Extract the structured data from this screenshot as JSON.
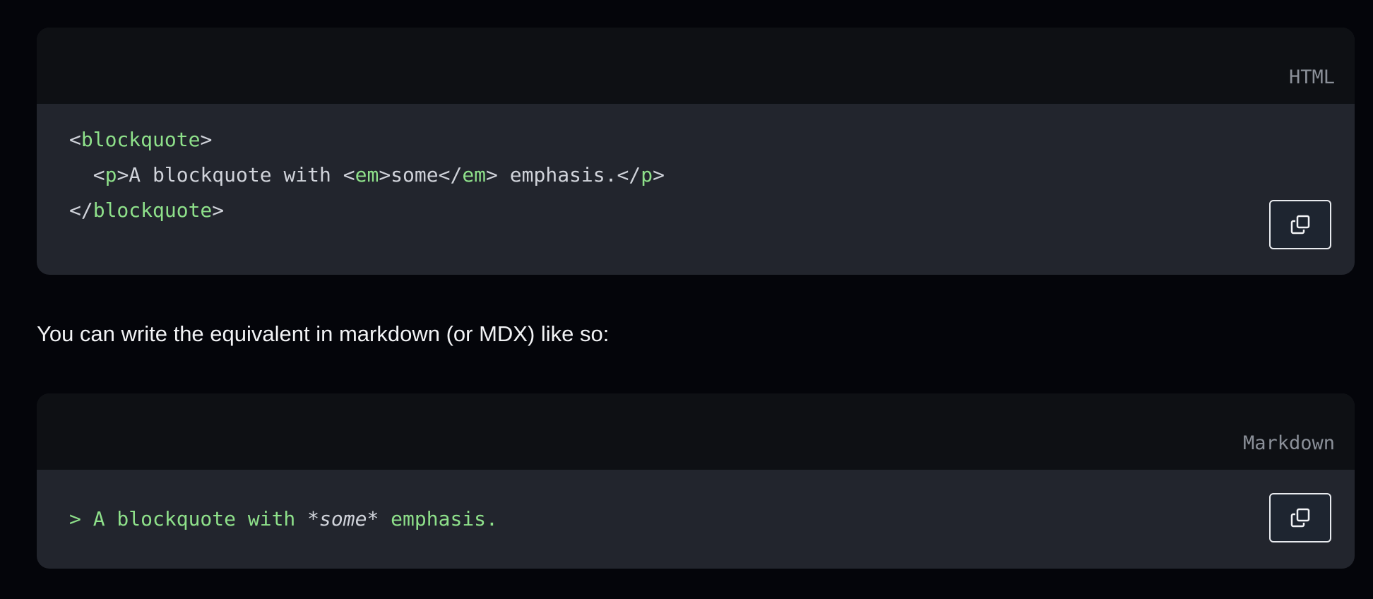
{
  "blocks": [
    {
      "language": "HTML",
      "lines": [
        [
          {
            "t": "<"
          },
          {
            "t": "blockquote",
            "g": 1
          },
          {
            "t": ">"
          }
        ],
        [
          {
            "t": "  <"
          },
          {
            "t": "p",
            "g": 1
          },
          {
            "t": ">A blockquote with <"
          },
          {
            "t": "em",
            "g": 1
          },
          {
            "t": ">some</"
          },
          {
            "t": "em",
            "g": 1
          },
          {
            "t": "> emphasis.</"
          },
          {
            "t": "p",
            "g": 1
          },
          {
            "t": ">"
          }
        ],
        [
          {
            "t": "</"
          },
          {
            "t": "blockquote",
            "g": 1
          },
          {
            "t": ">"
          }
        ]
      ]
    },
    {
      "language": "Markdown",
      "lines": [
        [
          {
            "t": "> A blockquote with ",
            "g": 1
          },
          {
            "t": "*some*",
            "i": 1
          },
          {
            "t": " emphasis.",
            "g": 1
          }
        ]
      ]
    }
  ],
  "paragraph": "You can write the equivalent in markdown (or MDX) like so:",
  "icons": {
    "copy": "copy-icon"
  },
  "colors": {
    "tag": "#8ee08a",
    "text": "#d0d3da",
    "label": "#8b9099"
  }
}
